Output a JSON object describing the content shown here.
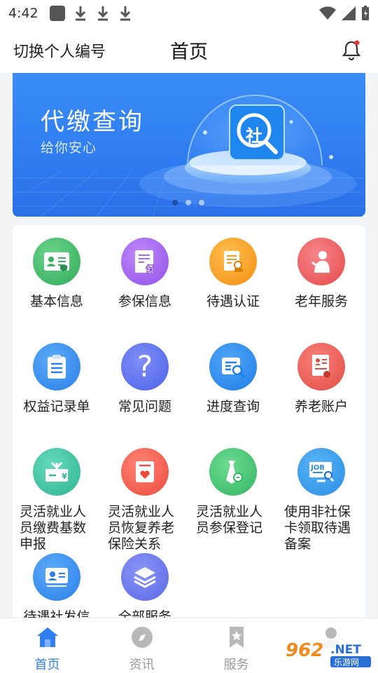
{
  "status_bar": {
    "time": "4:42"
  },
  "header": {
    "switch_label": "切换个人编号",
    "title": "首页"
  },
  "banner": {
    "title": "代缴查询",
    "subtitle": "给你安心",
    "badge_char": "社",
    "page_count": 3,
    "active_page": 1
  },
  "services": [
    {
      "label": "基本信息",
      "icon": "id-card-icon"
    },
    {
      "label": "参保信息",
      "icon": "insurance-doc-icon",
      "badge": "保"
    },
    {
      "label": "待遇认证",
      "icon": "certify-icon"
    },
    {
      "label": "老年服务",
      "icon": "elderly-icon"
    },
    {
      "label": "权益记录单",
      "icon": "clipboard-icon"
    },
    {
      "label": "常见问题",
      "icon": "question-icon",
      "glyph": "?"
    },
    {
      "label": "进度查询",
      "icon": "progress-search-icon"
    },
    {
      "label": "养老账户",
      "icon": "pension-account-icon"
    },
    {
      "label": "灵活就业人员缴费基数申报",
      "lines": [
        "灵活就业人",
        "员缴费基数",
        "申报"
      ],
      "icon": "payment-card-icon",
      "badge": "¥"
    },
    {
      "label": "灵活就业人员恢复养老保险关系",
      "lines": [
        "灵活就业人",
        "员恢复养老",
        "保险关系"
      ],
      "icon": "heart-card-icon"
    },
    {
      "label": "灵活就业人员参保登记",
      "lines": [
        "灵活就业人",
        "员参保登记"
      ],
      "icon": "tie-register-icon"
    },
    {
      "label": "使用非社保卡领取待遇备案",
      "lines": [
        "使用非社保",
        "卡领取待遇",
        "备案"
      ],
      "icon": "job-screen-icon",
      "badge": "JOB"
    },
    {
      "label": "待遇社发信",
      "icon": "benefit-card-icon"
    },
    {
      "label": "全部服务",
      "icon": "layers-icon"
    }
  ],
  "tabs": [
    {
      "label": "首页",
      "icon": "home-icon",
      "active": true
    },
    {
      "label": "资讯",
      "icon": "compass-icon",
      "active": false
    },
    {
      "label": "服务",
      "icon": "bookmark-star-icon",
      "active": false
    },
    {
      "label": "",
      "icon": "profile-icon",
      "active": false
    }
  ],
  "watermark": {
    "text_top": "962",
    "text_sub": ".NET",
    "text_bottom": "乐游网"
  },
  "colors": {
    "green": "#3fba6a",
    "purple": "#a05cf0",
    "orange": "#f59a1c",
    "red": "#ee5a52",
    "blue": "#3a8ff0",
    "indigo": "#6375ef",
    "teal": "#3dbfa0",
    "accent": "#2f7ff0"
  }
}
